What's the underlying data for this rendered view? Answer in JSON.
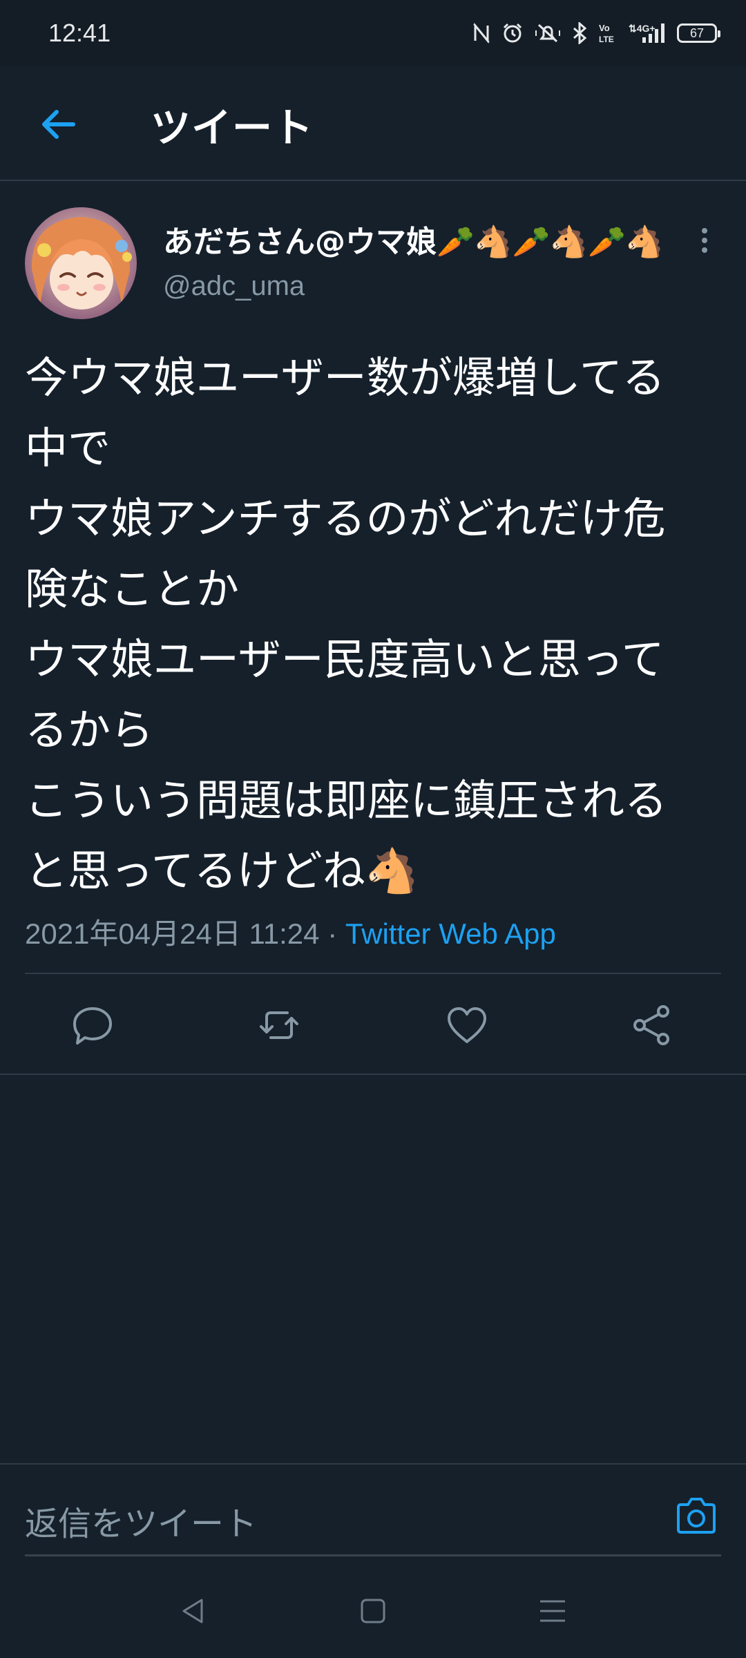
{
  "status_bar": {
    "time": "12:41",
    "battery": "67",
    "icons": [
      "nfc-icon",
      "alarm-icon",
      "silent-icon",
      "bluetooth-icon",
      "volte-icon",
      "4g-signal-icon",
      "battery-icon"
    ]
  },
  "header": {
    "title": "ツイート",
    "back_icon": "arrow-left-icon"
  },
  "tweet": {
    "display_name": "あだちさん@ウマ娘🥕🐴🥕🐴🥕🐴",
    "handle": "@adc_uma",
    "text_lines": [
      "今ウマ娘ユーザー数が爆増してる",
      "中で",
      "ウマ娘アンチするのがどれだけ危",
      "険なことか",
      "ウマ娘ユーザー民度高いと思って",
      "るから",
      "こういう問題は即座に鎮圧される",
      "と思ってるけどね🐴"
    ],
    "timestamp": "2021年04月24日 11:24 · ",
    "source": "Twitter Web App"
  },
  "actions": {
    "icons": [
      "reply-icon",
      "retweet-icon",
      "like-icon",
      "share-icon"
    ]
  },
  "reply": {
    "placeholder": "返信をツイート",
    "camera_icon": "camera-icon"
  },
  "colors": {
    "background": "#15202b",
    "accent": "#1da1f2",
    "secondary_text": "#8899a6"
  }
}
